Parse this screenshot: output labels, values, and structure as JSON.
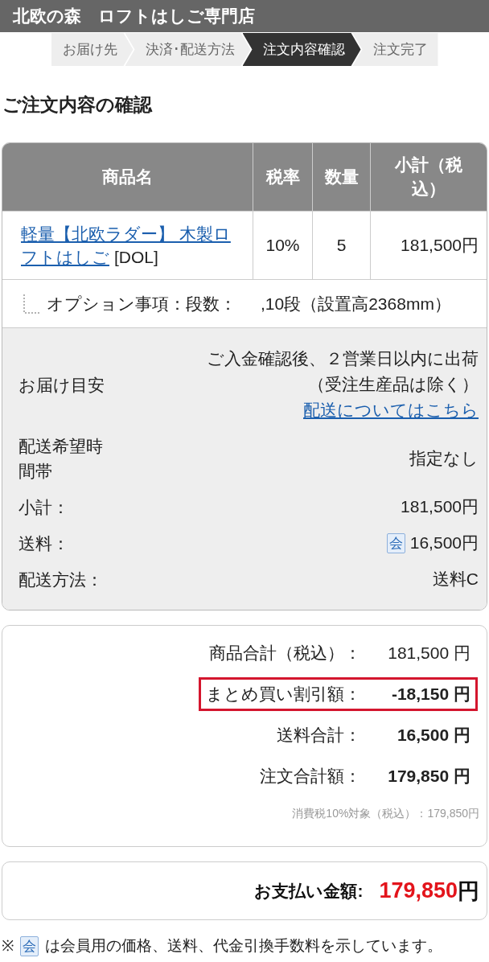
{
  "header": {
    "title": "北欧の森　ロフトはしご専門店"
  },
  "steps": [
    {
      "label": "お届け先",
      "selected": false
    },
    {
      "label": "決済･配送方法",
      "selected": false
    },
    {
      "label": "注文内容確認",
      "selected": true
    },
    {
      "label": "注文完了",
      "selected": false
    }
  ],
  "page_title": "ご注文内容の確認",
  "order_table": {
    "columns": [
      "商品名",
      "税率",
      "数量",
      "小計（税込）"
    ],
    "rows": [
      {
        "product_link_lines": [
          "軽量【北欧ラダー】 木製ロ",
          "フトはしご"
        ],
        "product_code": "[DOL]",
        "tax_rate": "10%",
        "quantity": "5",
        "subtotal": "181,500円",
        "option_label": "オプション事項：段数：",
        "option_value": ",10段（設置高2368mm）"
      }
    ]
  },
  "delivery_details": [
    {
      "label": "お届け目安",
      "value_lines": [
        "ご入金確認後、２営業日以内に出荷",
        "（受注生産品は除く）"
      ],
      "link": "配送についてはこちら"
    },
    {
      "label": "配送希望時間帯",
      "value": "指定なし"
    },
    {
      "label": "小計：",
      "value": "181,500円"
    },
    {
      "label": "送料：",
      "member_mark": "会",
      "value": "16,500円"
    },
    {
      "label": "配送方法：",
      "value": "送料C"
    }
  ],
  "summary": {
    "rows": [
      {
        "label": "商品合計（税込）：",
        "value": "181,500 円",
        "emphasized": false,
        "highlighted": false
      },
      {
        "label": "まとめ買い割引額：",
        "value": "-18,150 円",
        "emphasized": true,
        "highlighted": true
      },
      {
        "label": "送料合計：",
        "value": "16,500 円",
        "emphasized": true,
        "highlighted": false
      },
      {
        "label": "注文合計額：",
        "value": "179,850 円",
        "emphasized": true,
        "highlighted": false
      }
    ],
    "tax_note": "消費税10%対象（税込）：179,850円"
  },
  "payment": {
    "label": "お支払い金額:",
    "amount": "179,850",
    "currency": "円"
  },
  "footnote": {
    "symbol": "※",
    "member_mark": "会",
    "text": "は会員用の価格、送料、代金引換手数料を示しています。"
  }
}
